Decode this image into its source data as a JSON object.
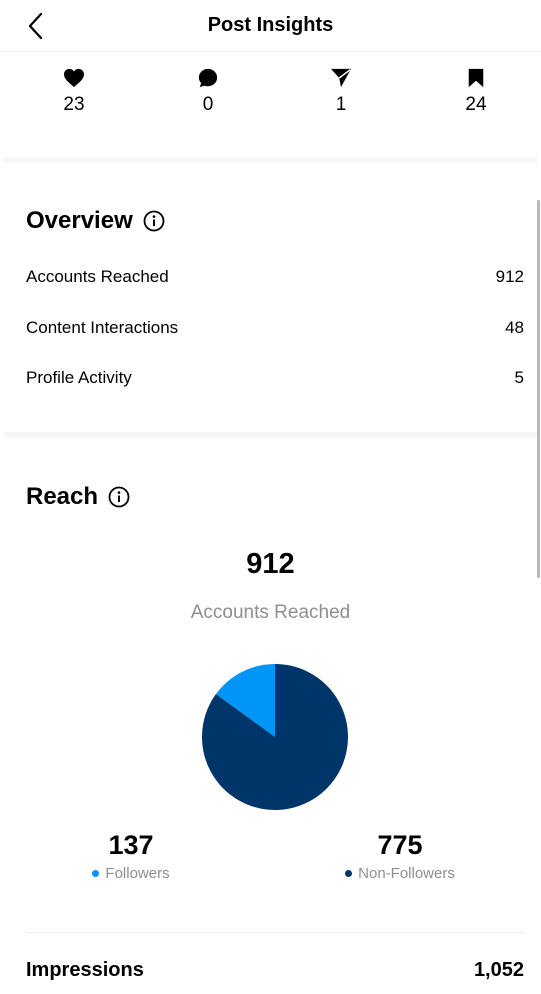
{
  "header": {
    "title": "Post Insights"
  },
  "stats": [
    {
      "icon": "heart-icon",
      "value": "23"
    },
    {
      "icon": "comment-icon",
      "value": "0"
    },
    {
      "icon": "share-icon",
      "value": "1"
    },
    {
      "icon": "bookmark-icon",
      "value": "24"
    }
  ],
  "overview": {
    "title": "Overview",
    "rows": [
      {
        "label": "Accounts Reached",
        "value": "912"
      },
      {
        "label": "Content Interactions",
        "value": "48"
      },
      {
        "label": "Profile Activity",
        "value": "5"
      }
    ]
  },
  "reach": {
    "title": "Reach",
    "total": "912",
    "caption": "Accounts Reached",
    "followers": {
      "value": "137",
      "label": "Followers",
      "color": "#0095f6"
    },
    "non_followers": {
      "value": "775",
      "label": "Non-Followers",
      "color": "#003569"
    }
  },
  "impressions": {
    "label": "Impressions",
    "value": "1,052"
  },
  "chart_data": {
    "type": "pie",
    "categories": [
      "Followers",
      "Non-Followers"
    ],
    "values": [
      137,
      775
    ],
    "colors": [
      "#0095f6",
      "#003569"
    ]
  }
}
